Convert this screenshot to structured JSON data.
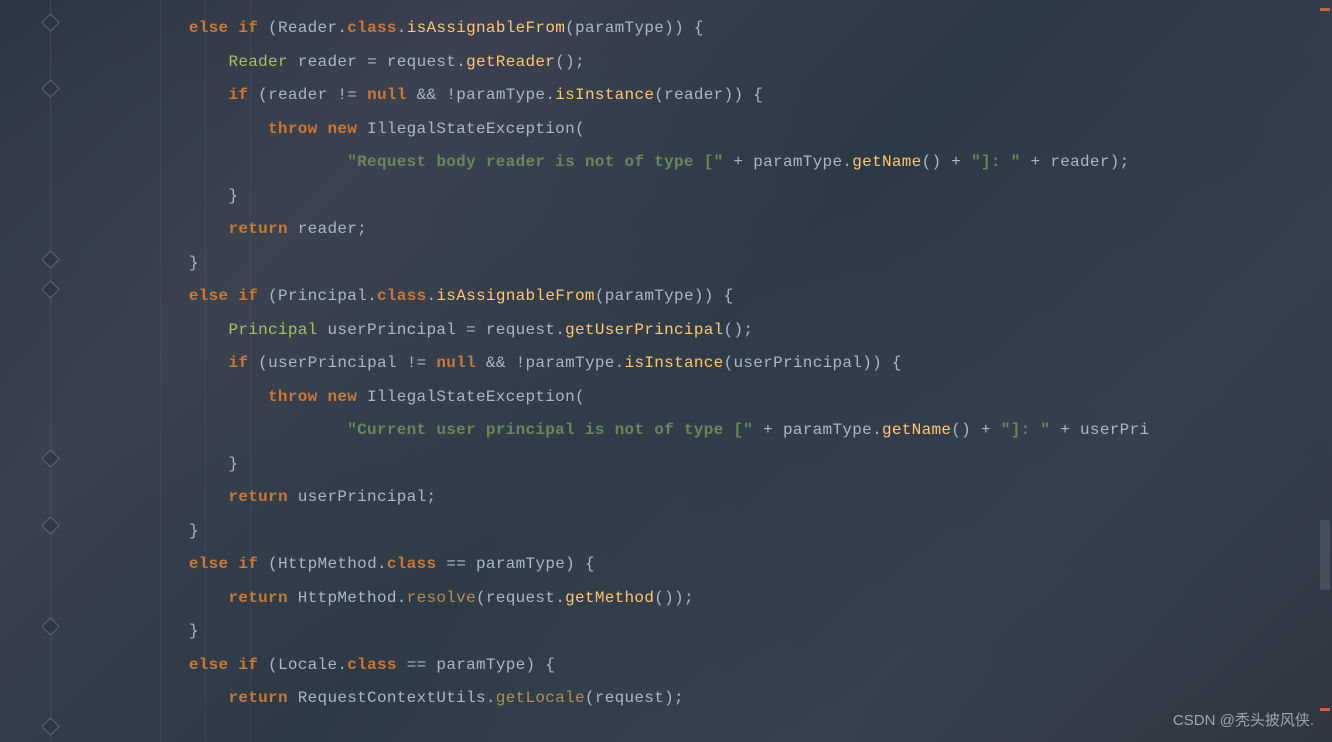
{
  "watermark": "CSDN @秃头披风侠.",
  "fold_markers": [
    16,
    82,
    253,
    283,
    452,
    519,
    620,
    720
  ],
  "vertical_guides": [
    90,
    135,
    180
  ],
  "code": {
    "tokens": [
      [
        {
          "t": "            ",
          "c": "op"
        },
        {
          "t": "else if ",
          "c": "kw"
        },
        {
          "t": "(",
          "c": "paren"
        },
        {
          "t": "Reader",
          "c": "var"
        },
        {
          "t": ".",
          "c": "op"
        },
        {
          "t": "class",
          "c": "kw"
        },
        {
          "t": ".",
          "c": "op"
        },
        {
          "t": "isAssignableFrom",
          "c": "method"
        },
        {
          "t": "(",
          "c": "paren"
        },
        {
          "t": "paramType",
          "c": "var"
        },
        {
          "t": ")) {",
          "c": "paren"
        }
      ],
      [
        {
          "t": "                ",
          "c": "op"
        },
        {
          "t": "Reader ",
          "c": "type"
        },
        {
          "t": "reader ",
          "c": "var"
        },
        {
          "t": "= ",
          "c": "op"
        },
        {
          "t": "request",
          "c": "var"
        },
        {
          "t": ".",
          "c": "op"
        },
        {
          "t": "getReader",
          "c": "method"
        },
        {
          "t": "();",
          "c": "paren"
        }
      ],
      [
        {
          "t": "                ",
          "c": "op"
        },
        {
          "t": "if ",
          "c": "kw"
        },
        {
          "t": "(",
          "c": "paren"
        },
        {
          "t": "reader ",
          "c": "var"
        },
        {
          "t": "!= ",
          "c": "op"
        },
        {
          "t": "null ",
          "c": "null"
        },
        {
          "t": "&& !",
          "c": "op"
        },
        {
          "t": "paramType",
          "c": "var"
        },
        {
          "t": ".",
          "c": "op"
        },
        {
          "t": "isInstance",
          "c": "method"
        },
        {
          "t": "(",
          "c": "paren"
        },
        {
          "t": "reader",
          "c": "var"
        },
        {
          "t": ")) {",
          "c": "paren"
        }
      ],
      [
        {
          "t": "                    ",
          "c": "op"
        },
        {
          "t": "throw new ",
          "c": "kw"
        },
        {
          "t": "IllegalStateException",
          "c": "var"
        },
        {
          "t": "(",
          "c": "paren"
        }
      ],
      [
        {
          "t": "                            ",
          "c": "op"
        },
        {
          "t": "\"Request body reader is not of type [\"",
          "c": "str"
        },
        {
          "t": " + ",
          "c": "op"
        },
        {
          "t": "paramType",
          "c": "var"
        },
        {
          "t": ".",
          "c": "op"
        },
        {
          "t": "getName",
          "c": "method"
        },
        {
          "t": "() + ",
          "c": "op"
        },
        {
          "t": "\"]: \"",
          "c": "str"
        },
        {
          "t": " + ",
          "c": "op"
        },
        {
          "t": "reader",
          "c": "var"
        },
        {
          "t": ");",
          "c": "paren"
        }
      ],
      [
        {
          "t": "                }",
          "c": "brace"
        }
      ],
      [
        {
          "t": "                ",
          "c": "op"
        },
        {
          "t": "return ",
          "c": "kw"
        },
        {
          "t": "reader",
          "c": "var"
        },
        {
          "t": ";",
          "c": "op"
        }
      ],
      [
        {
          "t": "            }",
          "c": "brace"
        }
      ],
      [
        {
          "t": "            ",
          "c": "op"
        },
        {
          "t": "else if ",
          "c": "kw"
        },
        {
          "t": "(",
          "c": "paren"
        },
        {
          "t": "Principal",
          "c": "var"
        },
        {
          "t": ".",
          "c": "op"
        },
        {
          "t": "class",
          "c": "kw"
        },
        {
          "t": ".",
          "c": "op"
        },
        {
          "t": "isAssignableFrom",
          "c": "method"
        },
        {
          "t": "(",
          "c": "paren"
        },
        {
          "t": "paramType",
          "c": "var"
        },
        {
          "t": ")) {",
          "c": "paren"
        }
      ],
      [
        {
          "t": "                ",
          "c": "op"
        },
        {
          "t": "Principal ",
          "c": "type"
        },
        {
          "t": "userPrincipal ",
          "c": "var"
        },
        {
          "t": "= ",
          "c": "op"
        },
        {
          "t": "request",
          "c": "var"
        },
        {
          "t": ".",
          "c": "op"
        },
        {
          "t": "getUserPrincipal",
          "c": "method"
        },
        {
          "t": "();",
          "c": "paren"
        }
      ],
      [
        {
          "t": "                ",
          "c": "op"
        },
        {
          "t": "if ",
          "c": "kw"
        },
        {
          "t": "(",
          "c": "paren"
        },
        {
          "t": "userPrincipal ",
          "c": "var"
        },
        {
          "t": "!= ",
          "c": "op"
        },
        {
          "t": "null ",
          "c": "null"
        },
        {
          "t": "&& !",
          "c": "op"
        },
        {
          "t": "paramType",
          "c": "var"
        },
        {
          "t": ".",
          "c": "op"
        },
        {
          "t": "isInstance",
          "c": "method"
        },
        {
          "t": "(",
          "c": "paren"
        },
        {
          "t": "userPrincipal",
          "c": "var"
        },
        {
          "t": ")) {",
          "c": "paren"
        }
      ],
      [
        {
          "t": "                    ",
          "c": "op"
        },
        {
          "t": "throw new ",
          "c": "kw"
        },
        {
          "t": "IllegalStateException",
          "c": "var"
        },
        {
          "t": "(",
          "c": "paren"
        }
      ],
      [
        {
          "t": "                            ",
          "c": "op"
        },
        {
          "t": "\"Current user principal is not of type [\"",
          "c": "str"
        },
        {
          "t": " + ",
          "c": "op"
        },
        {
          "t": "paramType",
          "c": "var"
        },
        {
          "t": ".",
          "c": "op"
        },
        {
          "t": "getName",
          "c": "method"
        },
        {
          "t": "() + ",
          "c": "op"
        },
        {
          "t": "\"]: \"",
          "c": "str"
        },
        {
          "t": " + ",
          "c": "op"
        },
        {
          "t": "userPri",
          "c": "var"
        }
      ],
      [
        {
          "t": "                }",
          "c": "brace"
        }
      ],
      [
        {
          "t": "                ",
          "c": "op"
        },
        {
          "t": "return ",
          "c": "kw"
        },
        {
          "t": "userPrincipal",
          "c": "var"
        },
        {
          "t": ";",
          "c": "op"
        }
      ],
      [
        {
          "t": "            }",
          "c": "brace"
        }
      ],
      [
        {
          "t": "            ",
          "c": "op"
        },
        {
          "t": "else if ",
          "c": "kw"
        },
        {
          "t": "(",
          "c": "paren"
        },
        {
          "t": "HttpMethod",
          "c": "var"
        },
        {
          "t": ".",
          "c": "op"
        },
        {
          "t": "class ",
          "c": "kw"
        },
        {
          "t": "== ",
          "c": "op"
        },
        {
          "t": "paramType",
          "c": "var"
        },
        {
          "t": ") {",
          "c": "paren"
        }
      ],
      [
        {
          "t": "                ",
          "c": "op"
        },
        {
          "t": "return ",
          "c": "kw"
        },
        {
          "t": "HttpMethod",
          "c": "var"
        },
        {
          "t": ".",
          "c": "op"
        },
        {
          "t": "resolve",
          "c": "method2"
        },
        {
          "t": "(",
          "c": "paren"
        },
        {
          "t": "request",
          "c": "var"
        },
        {
          "t": ".",
          "c": "op"
        },
        {
          "t": "getMethod",
          "c": "method"
        },
        {
          "t": "());",
          "c": "paren"
        }
      ],
      [
        {
          "t": "            }",
          "c": "brace"
        }
      ],
      [
        {
          "t": "            ",
          "c": "op"
        },
        {
          "t": "else if ",
          "c": "kw"
        },
        {
          "t": "(",
          "c": "paren"
        },
        {
          "t": "Locale",
          "c": "var"
        },
        {
          "t": ".",
          "c": "op"
        },
        {
          "t": "class ",
          "c": "kw"
        },
        {
          "t": "== ",
          "c": "op"
        },
        {
          "t": "paramType",
          "c": "var"
        },
        {
          "t": ") {",
          "c": "paren"
        }
      ],
      [
        {
          "t": "                ",
          "c": "op"
        },
        {
          "t": "return ",
          "c": "kw"
        },
        {
          "t": "RequestContextUtils",
          "c": "var"
        },
        {
          "t": ".",
          "c": "op"
        },
        {
          "t": "getLocale",
          "c": "method2"
        },
        {
          "t": "(",
          "c": "paren"
        },
        {
          "t": "request",
          "c": "var"
        },
        {
          "t": ");",
          "c": "paren"
        }
      ]
    ]
  },
  "scroll_marks": [
    8,
    708
  ]
}
